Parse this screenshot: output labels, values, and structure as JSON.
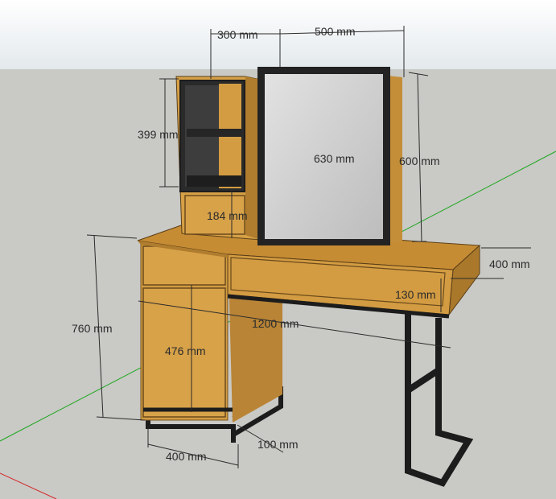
{
  "dimensions": {
    "top_cabinet_width": "300 mm",
    "mirror_width": "500 mm",
    "cabinet_height": "399 mm",
    "mirror_height": "630 mm",
    "mirror_frame_height": "600 mm",
    "drawer_box_height": "184 mm",
    "table_depth": "400 mm",
    "drawer_front_height": "130 mm",
    "table_height": "760 mm",
    "table_width": "1200 mm",
    "door_height": "476 mm",
    "base_depth": "400 mm",
    "leg_base_height": "100 mm"
  },
  "colors": {
    "sky": "#e4ebee",
    "ground": "#c9c9c6",
    "wood": "#d19a3e",
    "wood_dark": "#ad7a2a",
    "wood_top": "#c78f35",
    "metal": "#1c1c1c",
    "mirror": "#d2d2d2",
    "axis_green": "#1fa81f",
    "axis_red": "#d42a2a",
    "dim_line": "#2b2b2b"
  }
}
